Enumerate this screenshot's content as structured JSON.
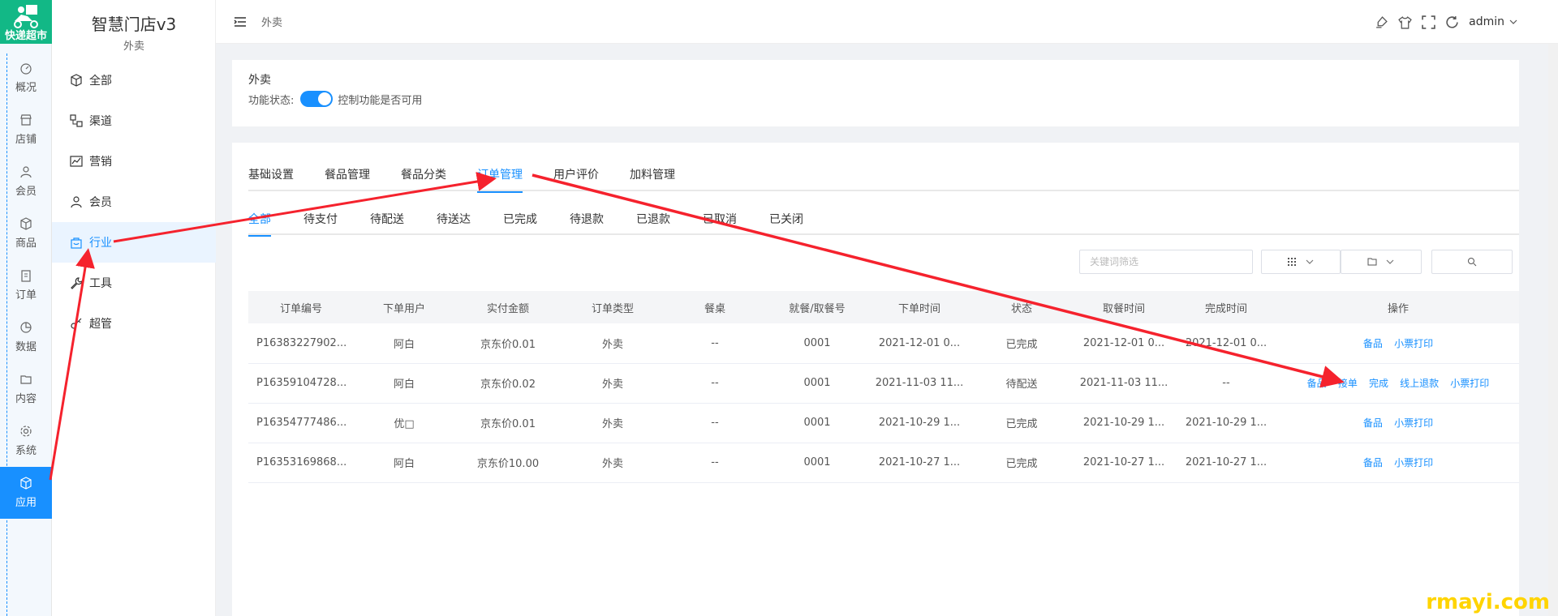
{
  "logo": {
    "text": "快递超市"
  },
  "rail": {
    "items": [
      {
        "label": "概况",
        "icon": "dashboard-icon"
      },
      {
        "label": "店铺",
        "icon": "store-icon"
      },
      {
        "label": "会员",
        "icon": "user-icon"
      },
      {
        "label": "商品",
        "icon": "cube-icon"
      },
      {
        "label": "订单",
        "icon": "clipboard-icon"
      },
      {
        "label": "数据",
        "icon": "pie-chart-icon"
      },
      {
        "label": "内容",
        "icon": "folder-icon"
      },
      {
        "label": "系统",
        "icon": "gear-icon"
      },
      {
        "label": "应用",
        "icon": "cube-icon"
      }
    ]
  },
  "sidebar": {
    "title": "智慧门店v3",
    "subtitle": "外卖",
    "items": [
      {
        "label": "全部",
        "icon": "cube-icon"
      },
      {
        "label": "渠道",
        "icon": "channel-icon"
      },
      {
        "label": "营销",
        "icon": "line-chart-icon"
      },
      {
        "label": "会员",
        "icon": "user-icon"
      },
      {
        "label": "行业",
        "icon": "shop-bag-icon"
      },
      {
        "label": "工具",
        "icon": "wrench-icon"
      },
      {
        "label": "超管",
        "icon": "key-icon"
      }
    ]
  },
  "header": {
    "breadcrumb": "外卖",
    "user": "admin"
  },
  "feature": {
    "title": "外卖",
    "status_label": "功能状态:",
    "status_desc": "控制功能是否可用"
  },
  "tabs": [
    "基础设置",
    "餐品管理",
    "餐品分类",
    "订单管理",
    "用户评价",
    "加料管理"
  ],
  "subtabs": [
    "全部",
    "待支付",
    "待配送",
    "待送达",
    "已完成",
    "待退款",
    "已退款",
    "已取消",
    "已关闭"
  ],
  "filter": {
    "placeholder": "关键词筛选"
  },
  "table": {
    "headers": [
      "订单编号",
      "下单用户",
      "实付金额",
      "订单类型",
      "餐桌",
      "就餐/取餐号",
      "下单时间",
      "状态",
      "取餐时间",
      "完成时间",
      "操作"
    ],
    "rows": [
      {
        "id": "P16383227902...",
        "user": "阿白",
        "amount": "京东价0.01",
        "type": "外卖",
        "table": "--",
        "num": "0001",
        "order_time": "2021-12-01 0...",
        "status": "已完成",
        "pickup": "2021-12-01 0...",
        "finish": "2021-12-01 0...",
        "ops": [
          "备品",
          "小票打印"
        ]
      },
      {
        "id": "P16359104728...",
        "user": "阿白",
        "amount": "京东价0.02",
        "type": "外卖",
        "table": "--",
        "num": "0001",
        "order_time": "2021-11-03 11...",
        "status": "待配送",
        "pickup": "2021-11-03 11...",
        "finish": "--",
        "ops": [
          "备品",
          "接单",
          "完成",
          "线上退款",
          "小票打印"
        ]
      },
      {
        "id": "P16354777486...",
        "user": "优□",
        "amount": "京东价0.01",
        "type": "外卖",
        "table": "--",
        "num": "0001",
        "order_time": "2021-10-29 1...",
        "status": "已完成",
        "pickup": "2021-10-29 1...",
        "finish": "2021-10-29 1...",
        "ops": [
          "备品",
          "小票打印"
        ]
      },
      {
        "id": "P16353169868...",
        "user": "阿白",
        "amount": "京东价10.00",
        "type": "外卖",
        "table": "--",
        "num": "0001",
        "order_time": "2021-10-27 1...",
        "status": "已完成",
        "pickup": "2021-10-27 1...",
        "finish": "2021-10-27 1...",
        "ops": [
          "备品",
          "小票打印"
        ]
      }
    ]
  },
  "watermark": "rmayi.com",
  "colors": {
    "accent": "#1890ff",
    "logo_bg": "#12b886",
    "arrow": "#f5222d"
  }
}
